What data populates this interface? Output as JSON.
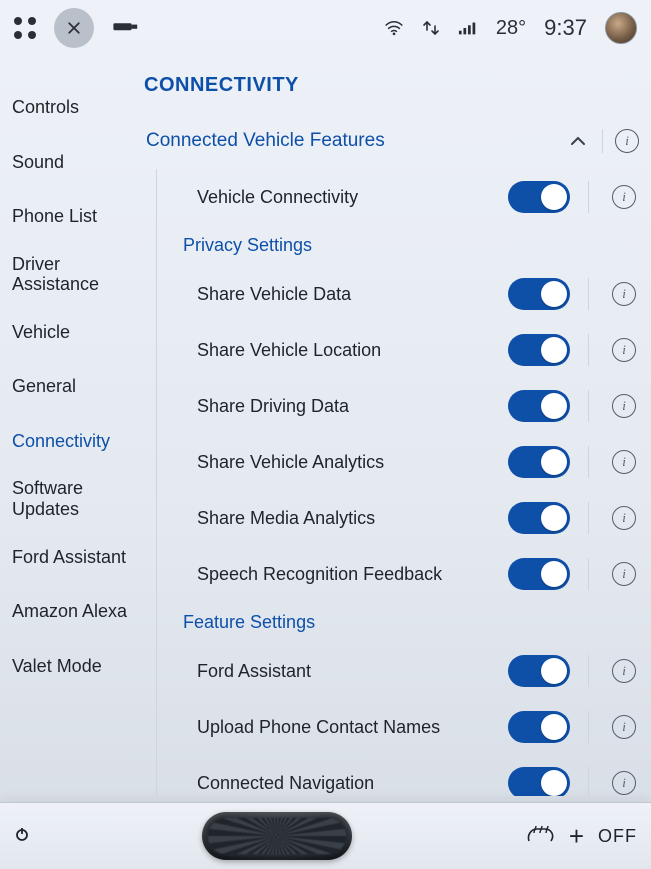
{
  "status": {
    "temp": "28°",
    "time": "9:37"
  },
  "sidebar": {
    "items": [
      {
        "label": "Controls"
      },
      {
        "label": "Sound"
      },
      {
        "label": "Phone List"
      },
      {
        "label": "Driver Assistance"
      },
      {
        "label": "Vehicle"
      },
      {
        "label": "General"
      },
      {
        "label": "Connectivity",
        "active": true
      },
      {
        "label": "Software Updates"
      },
      {
        "label": "Ford Assistant"
      },
      {
        "label": "Amazon Alexa"
      },
      {
        "label": "Valet Mode"
      }
    ]
  },
  "page": {
    "title": "CONNECTIVITY",
    "section": "Connected Vehicle Features",
    "groups": [
      {
        "title": null,
        "rows": [
          {
            "label": "Vehicle Connectivity",
            "on": true,
            "info": true
          }
        ]
      },
      {
        "title": "Privacy Settings",
        "rows": [
          {
            "label": "Share Vehicle Data",
            "on": true,
            "info": true
          },
          {
            "label": "Share Vehicle Location",
            "on": true,
            "info": true
          },
          {
            "label": "Share Driving Data",
            "on": true,
            "info": true
          },
          {
            "label": "Share Vehicle Analytics",
            "on": true,
            "info": true
          },
          {
            "label": "Share Media Analytics",
            "on": true,
            "info": true
          },
          {
            "label": "Speech Recognition Feedback",
            "on": true,
            "info": true
          }
        ]
      },
      {
        "title": "Feature Settings",
        "rows": [
          {
            "label": "Ford Assistant",
            "on": true,
            "info": true
          },
          {
            "label": "Upload Phone Contact Names",
            "on": true,
            "info": true
          },
          {
            "label": "Connected Navigation",
            "on": true,
            "info": true
          }
        ]
      }
    ]
  },
  "bottom": {
    "off": "OFF"
  }
}
